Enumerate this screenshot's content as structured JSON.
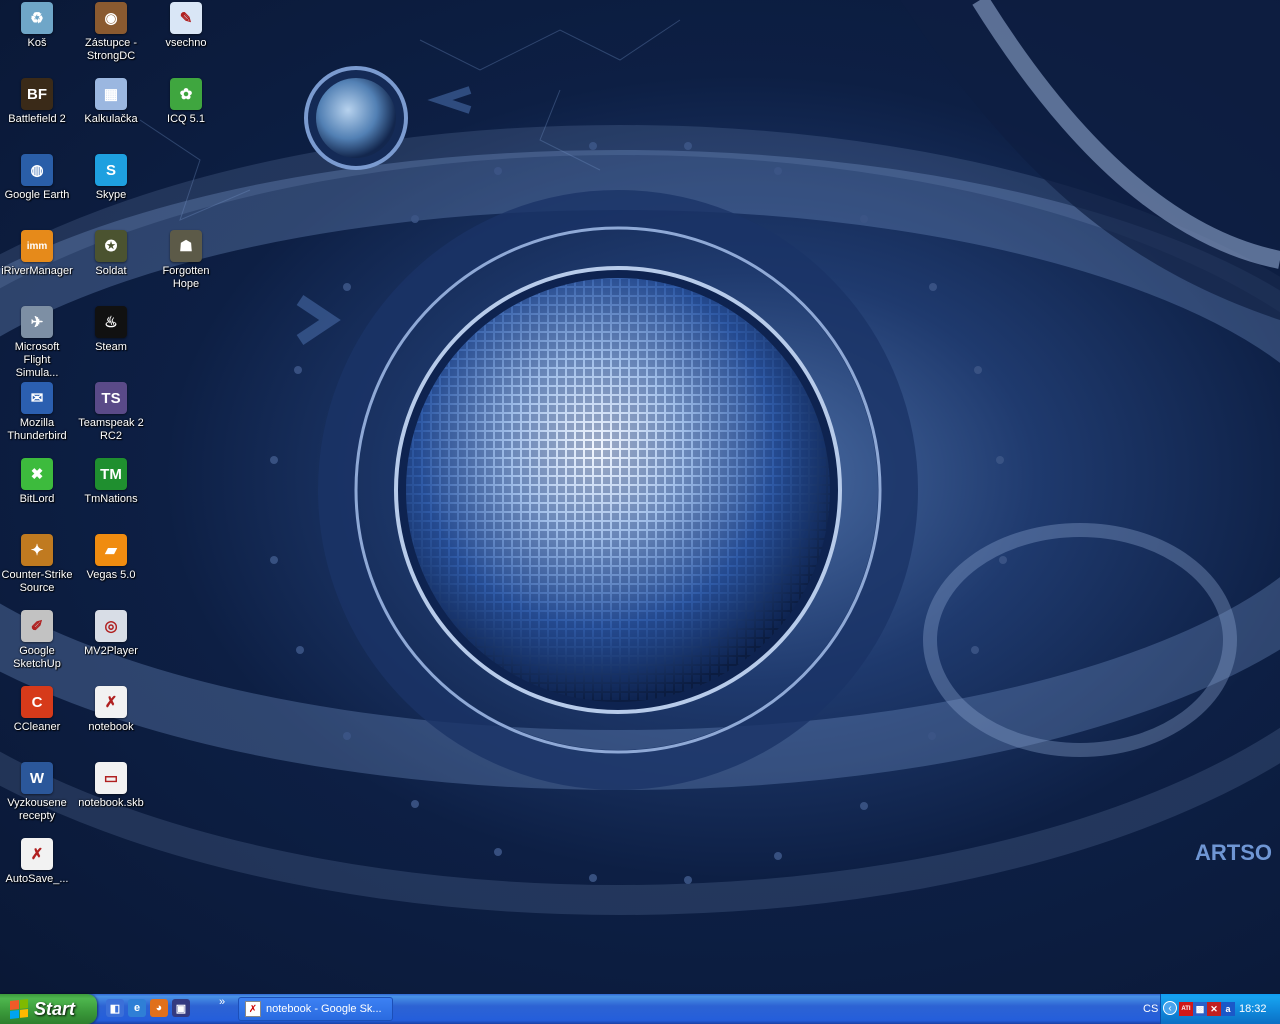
{
  "desktop": {
    "icons": [
      {
        "label": "Koš",
        "icon": "recycle-bin-icon",
        "color": "#6fa6c8",
        "glyph": "♻"
      },
      {
        "label": "Zástupce - StrongDC",
        "icon": "strongdc-icon",
        "color": "#8a5a30",
        "glyph": "◉"
      },
      {
        "label": "vsechno",
        "icon": "document-icon",
        "color": "#d9e6f6",
        "glyph": "✎"
      },
      {
        "label": "Battlefield 2",
        "icon": "battlefield-icon",
        "color": "#3a2a18",
        "glyph": "BF"
      },
      {
        "label": "Kalkulačka",
        "icon": "calculator-icon",
        "color": "#9bb7e0",
        "glyph": "▦"
      },
      {
        "label": "ICQ 5.1",
        "icon": "icq-flower-icon",
        "color": "#3fa63f",
        "glyph": "✿"
      },
      {
        "label": "Google Earth",
        "icon": "google-earth-icon",
        "color": "#2a5ea8",
        "glyph": "◍"
      },
      {
        "label": "Skype",
        "icon": "skype-icon",
        "color": "#1ea0e0",
        "glyph": "S"
      },
      {
        "label": "iRiverManager",
        "icon": "iriver-manager-icon",
        "color": "#e68a1a",
        "glyph": "imm"
      },
      {
        "label": "Soldat",
        "icon": "soldat-icon",
        "color": "#4b5330",
        "glyph": "✪"
      },
      {
        "label": "Forgotten Hope",
        "icon": "forgotten-hope-icon",
        "color": "#5c5a48",
        "glyph": "☗"
      },
      {
        "label": "Microsoft Flight Simula...",
        "icon": "airplane-icon",
        "color": "#7d8fa4",
        "glyph": "✈"
      },
      {
        "label": "Steam",
        "icon": "steam-icon",
        "color": "#111111",
        "glyph": "♨"
      },
      {
        "label": "Mozilla Thunderbird",
        "icon": "thunderbird-icon",
        "color": "#2b5fb0",
        "glyph": "✉"
      },
      {
        "label": "Teamspeak 2 RC2",
        "icon": "teamspeak-icon",
        "color": "#5a4a88",
        "glyph": "TS"
      },
      {
        "label": "BitLord",
        "icon": "bitlord-icon",
        "color": "#3dbb3d",
        "glyph": "✖"
      },
      {
        "label": "TmNations",
        "icon": "tmnations-icon",
        "color": "#1f8f2f",
        "glyph": "TM"
      },
      {
        "label": "Counter-Strike Source",
        "icon": "counter-strike-icon",
        "color": "#c07a20",
        "glyph": "✦"
      },
      {
        "label": "Vegas 5.0",
        "icon": "vegas-icon",
        "color": "#f08c10",
        "glyph": "▰"
      },
      {
        "label": "Google SketchUp",
        "icon": "sketchup-icon",
        "color": "#c2c2c2",
        "glyph": "✐"
      },
      {
        "label": "MV2Player",
        "icon": "mv2player-icon",
        "color": "#d8dde6",
        "glyph": "◎"
      },
      {
        "label": "CCleaner",
        "icon": "ccleaner-icon",
        "color": "#d63a1a",
        "glyph": "C"
      },
      {
        "label": "notebook",
        "icon": "sketchup-file-icon",
        "color": "#f2f2f2",
        "glyph": "✗"
      },
      {
        "label": "Vyzkousene recepty",
        "icon": "word-document-icon",
        "color": "#2b579a",
        "glyph": "W"
      },
      {
        "label": "notebook.skb",
        "icon": "skb-file-icon",
        "color": "#f2f2f2",
        "glyph": "▭"
      },
      {
        "label": "AutoSave_...",
        "icon": "sketchup-file-icon",
        "color": "#f2f2f2",
        "glyph": "✗"
      }
    ],
    "watermark": "ARTSO"
  },
  "taskbar": {
    "start_label": "Start",
    "quick_launch": [
      {
        "icon": "show-desktop-icon",
        "color": "#3b6fd8",
        "glyph": "◧"
      },
      {
        "icon": "internet-explorer-icon",
        "color": "#2f7fd6",
        "glyph": "e"
      },
      {
        "icon": "firefox-icon",
        "color": "#e0701c",
        "glyph": "◕"
      },
      {
        "icon": "floppy-save-icon",
        "color": "#333a80",
        "glyph": "▣"
      }
    ],
    "chevron": "»",
    "tasks": [
      {
        "label": "notebook - Google Sk...",
        "icon": "sketchup-icon"
      }
    ],
    "language": "CS",
    "tray_icons": [
      {
        "icon": "ati-icon",
        "color": "#d01818",
        "glyph": "ATI"
      },
      {
        "icon": "network-icon",
        "color": "#2a60c8",
        "glyph": "▩"
      },
      {
        "icon": "security-icon",
        "color": "#c02020",
        "glyph": "✕"
      },
      {
        "icon": "messenger-icon",
        "color": "#1a58c8",
        "glyph": "a"
      }
    ],
    "clock": "18:32"
  },
  "colors": {
    "taskbar_blue": "#245edb",
    "start_green": "#3a993a",
    "tray_blue": "#0f86d9"
  }
}
